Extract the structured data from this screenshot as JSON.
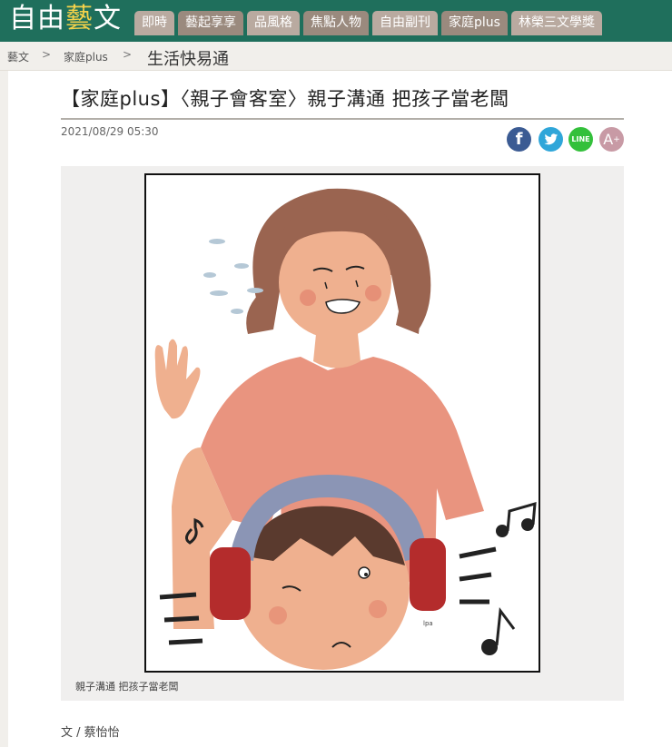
{
  "site": {
    "logo_main": "自由",
    "logo_accent": "藝",
    "logo_end": "文"
  },
  "nav": {
    "tabs": [
      "即時",
      "藝起享享",
      "品風格",
      "焦點人物",
      "自由副刊",
      "家庭plus",
      "林榮三文學獎"
    ]
  },
  "breadcrumb": {
    "home": "藝文",
    "section": "家庭plus",
    "separator": ">",
    "current": "生活快易通"
  },
  "article": {
    "title": "【家庭plus】〈親子會客室〉親子溝通 把孩子當老闆",
    "date": "2021/08/29 05:30",
    "caption": "親子溝通 把孩子當老闆",
    "author": "文 / 蔡怡怡"
  },
  "share": {
    "facebook_icon": "f",
    "line_icon": "LINE",
    "font_icon": "A",
    "font_plus": "+"
  },
  "illustration": {
    "signature": "lpa"
  },
  "colors": {
    "topbar": "#1f6f5c",
    "tab": "#b9aaa0",
    "facebook": "#3b5b93",
    "twitter": "#2fa6d9",
    "line": "#33c03b"
  }
}
